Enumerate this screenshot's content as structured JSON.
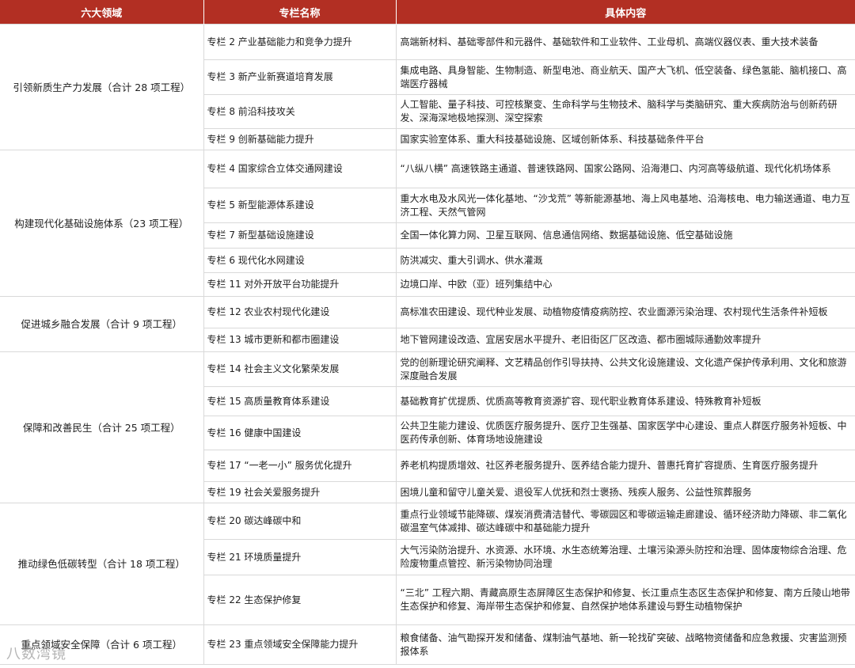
{
  "headers": [
    "六大领域",
    "专栏名称",
    "具体内容"
  ],
  "domains": [
    {
      "name": "引领新质生产力发展（合计 28 项工程）",
      "rows": [
        {
          "col": "专栏 2 产业基础能力和竞争力提升",
          "content": "高端新材料、基础零部件和元器件、基础软件和工业软件、工业母机、高端仪器仪表、重大技术装备"
        },
        {
          "col": "专栏 3 新产业新赛道培育发展",
          "content": "集成电路、具身智能、生物制造、新型电池、商业航天、国产大飞机、低空装备、绿色氢能、脑机接口、高端医疗器械"
        },
        {
          "col": "专栏 8 前沿科技攻关",
          "content": "人工智能、量子科技、可控核聚变、生命科学与生物技术、脑科学与类脑研究、重大疾病防治与创新药研发、深海深地极地探测、深空探索"
        },
        {
          "col": "专栏 9 创新基础能力提升",
          "content": "国家实验室体系、重大科技基础设施、区域创新体系、科技基础条件平台"
        }
      ]
    },
    {
      "name": "构建现代化基础设施体系（23 项工程）",
      "rows": [
        {
          "col": "专栏 4 国家综合立体交通网建设",
          "content": "“八纵八横” 高速铁路主通道、普速铁路网、国家公路网、沿海港口、内河高等级航道、现代化机场体系"
        },
        {
          "col": "专栏 5 新型能源体系建设",
          "content": "重大水电及水风光一体化基地、“沙戈荒” 等新能源基地、海上风电基地、沿海核电、电力输送通道、电力互济工程、天然气管网"
        },
        {
          "col": "专栏 7 新型基础设施建设",
          "content": "全国一体化算力网、卫星互联网、信息通信网络、数据基础设施、低空基础设施"
        },
        {
          "col": "专栏 6 现代化水网建设",
          "content": "防洪减灾、重大引调水、供水灌溉"
        },
        {
          "col": "专栏 11 对外开放平台功能提升",
          "content": "边境口岸、中欧（亚）班列集结中心"
        }
      ]
    },
    {
      "name": "促进城乡融合发展（合计 9 项工程）",
      "rows": [
        {
          "col": "专栏 12 农业农村现代化建设",
          "content": "高标准农田建设、现代种业发展、动植物疫情疫病防控、农业面源污染治理、农村现代生活条件补短板"
        },
        {
          "col": "专栏 13 城市更新和都市圈建设",
          "content": "地下管网建设改造、宜居安居水平提升、老旧街区厂区改造、都市圈城际通勤效率提升"
        }
      ]
    },
    {
      "name": "保障和改善民生（合计 25 项工程）",
      "rows": [
        {
          "col": "专栏 14 社会主义文化繁荣发展",
          "content": "党的创新理论研究阐释、文艺精品创作引导扶持、公共文化设施建设、文化遗产保护传承利用、文化和旅游深度融合发展"
        },
        {
          "col": "专栏 15 高质量教育体系建设",
          "content": "基础教育扩优提质、优质高等教育资源扩容、现代职业教育体系建设、特殊教育补短板"
        },
        {
          "col": "专栏 16 健康中国建设",
          "content": "公共卫生能力建设、优质医疗服务提升、医疗卫生强基、国家医学中心建设、重点人群医疗服务补短板、中医药传承创新、体育场地设施建设"
        },
        {
          "col": "专栏 17 “一老一小” 服务优化提升",
          "content": "养老机构提质增效、社区养老服务提升、医养结合能力提升、普惠托育扩容提质、生育医疗服务提升"
        },
        {
          "col": "专栏 19 社会关爱服务提升",
          "content": "困境儿童和留守儿童关爱、退役军人优抚和烈士褒扬、残疾人服务、公益性殡葬服务"
        }
      ]
    },
    {
      "name": "推动绿色低碳转型（合计 18 项工程）",
      "rows": [
        {
          "col": "专栏 20 碳达峰碳中和",
          "content": "重点行业领域节能降碳、煤炭消费清洁替代、零碳园区和零碳运输走廊建设、循环经济助力降碳、非二氧化碳温室气体减排、碳达峰碳中和基础能力提升"
        },
        {
          "col": "专栏 21 环境质量提升",
          "content": "大气污染防治提升、水资源、水环境、水生态统筹治理、土壤污染源头防控和治理、固体废物综合治理、危险废物重点管控、新污染物协同治理"
        },
        {
          "col": "专栏 22 生态保护修复",
          "content": "“三北” 工程六期、青藏高原生态屏障区生态保护和修复、长江重点生态区生态保护和修复、南方丘陵山地带生态保护和修复、海岸带生态保护和修复、自然保护地体系建设与野生动植物保护"
        }
      ]
    },
    {
      "name": "重点领域安全保障（合计 6 项工程）",
      "rows": [
        {
          "col": "专栏 23 重点领域安全保障能力提升",
          "content": "粮食储备、油气勘探开发和储备、煤制油气基地、新一轮找矿突破、战略物资储备和应急救援、灾害监测预报体系"
        }
      ]
    }
  ],
  "watermark": "八数湾镜"
}
